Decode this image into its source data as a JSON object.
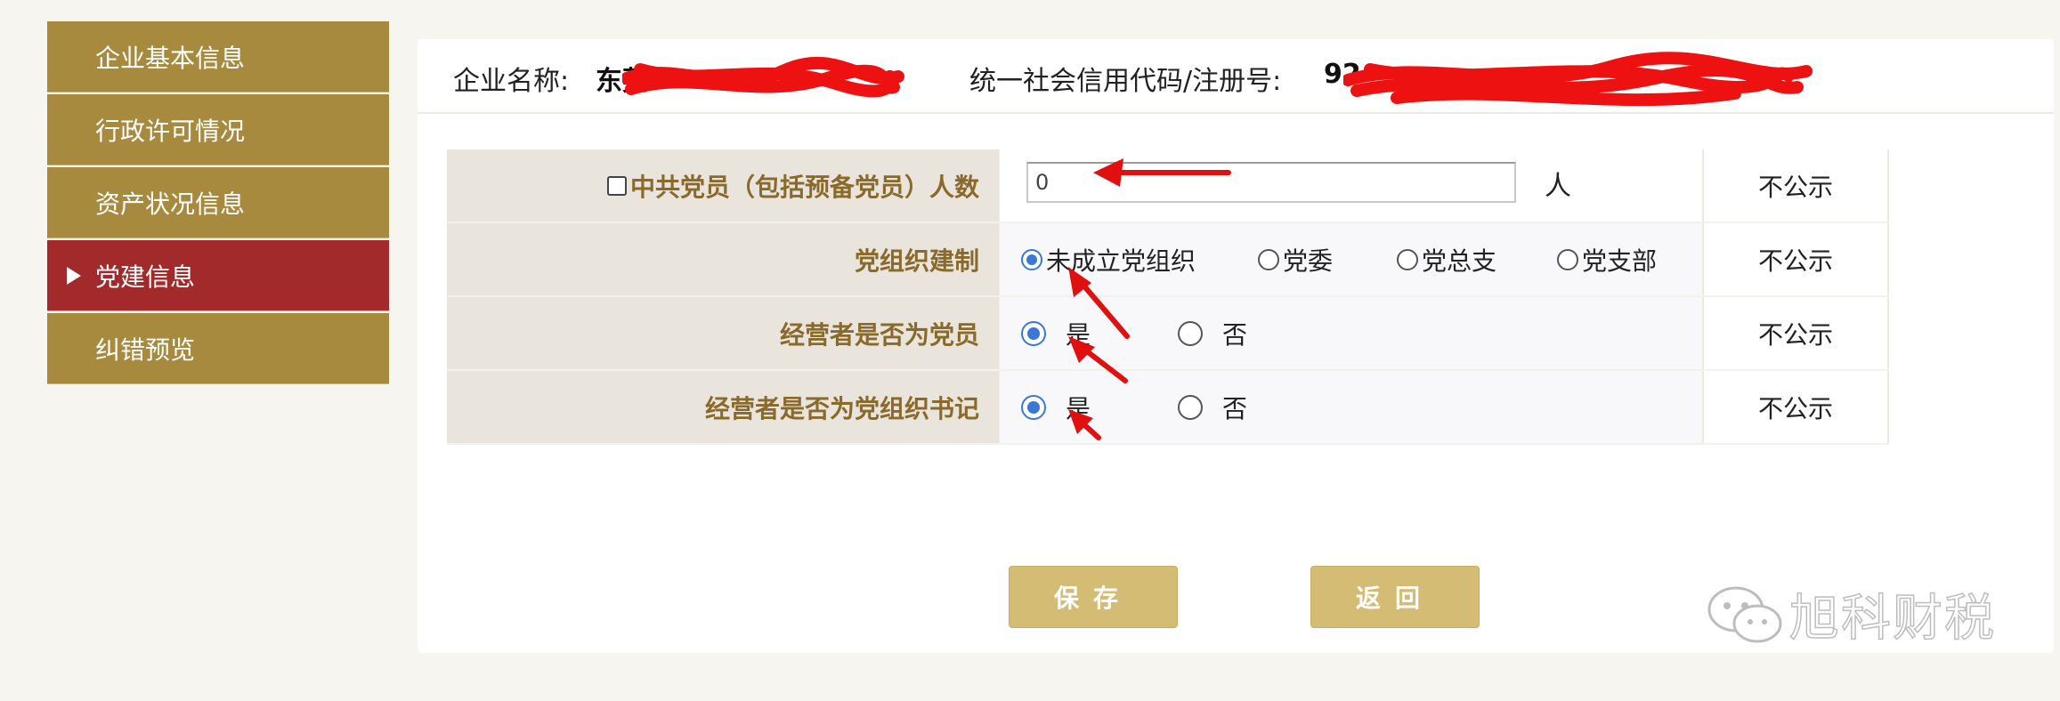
{
  "sidebar": {
    "items": [
      {
        "label": "企业基本信息"
      },
      {
        "label": "行政许可情况"
      },
      {
        "label": "资产状况信息"
      },
      {
        "label": "党建信息"
      },
      {
        "label": "纠错预览"
      }
    ]
  },
  "header": {
    "company_label": "企业名称:",
    "company_value": "东莞",
    "code_label": "统一社会信用代码/注册号:",
    "code_value": "92"
  },
  "form": {
    "rows": [
      {
        "label": "中共党员（包括预备党员）人数",
        "value": "0",
        "unit": "人",
        "publicity": "不公示"
      },
      {
        "label": "党组织建制",
        "options": [
          "未成立党组织",
          "党委",
          "党总支",
          "党支部"
        ],
        "selected": "未成立党组织",
        "publicity": "不公示"
      },
      {
        "label": "经营者是否为党员",
        "options": [
          "是",
          "否"
        ],
        "selected": "是",
        "publicity": "不公示"
      },
      {
        "label": "经营者是否为党组织书记",
        "options": [
          "是",
          "否"
        ],
        "selected": "是",
        "publicity": "不公示"
      }
    ]
  },
  "buttons": {
    "save": "保存",
    "back": "返回"
  },
  "watermark": "旭科财税",
  "colors": {
    "sidebar": "#a88a3e",
    "sidebar_active": "#a22a2b",
    "label_text": "#8a6a2a",
    "button": "#d4bc74",
    "radio_selected": "#3a78d8",
    "annotation": "#e01010"
  }
}
